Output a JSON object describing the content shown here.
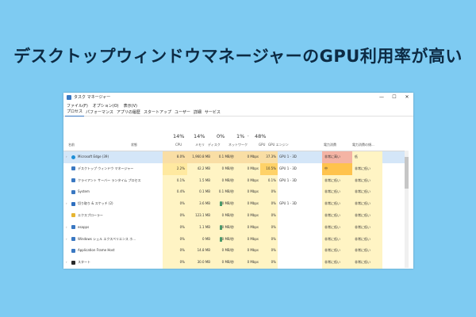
{
  "headline": "デスクトップウィンドウマネージャーのGPU利用率が高い",
  "window": {
    "title": "タスク マネージャー",
    "controls": [
      "—",
      "☐",
      "✕"
    ],
    "menu": [
      "ファイル(F)",
      "オプション(O)",
      "表示(V)"
    ],
    "tabs": [
      "プロセス",
      "パフォーマンス",
      "アプリの履歴",
      "スタートアップ",
      "ユーザー",
      "詳細",
      "サービス"
    ],
    "columns": {
      "name": "名前",
      "status": "状態",
      "cpu": {
        "pct": "14%",
        "label": "CPU"
      },
      "memory": {
        "pct": "14%",
        "label": "メモリ"
      },
      "disk": {
        "pct": "0%",
        "label": "ディスク"
      },
      "network": {
        "pct": "1%",
        "label": "ネットワーク"
      },
      "gpu": {
        "pct": "48%",
        "label": "GPU"
      },
      "gpu_engine": {
        "label": "GPU エンジン"
      },
      "power": {
        "label": "電力消費"
      },
      "power_trend": {
        "label": "電力消費の傾..."
      }
    },
    "rows": [
      {
        "name": "Microsoft Edge (39)",
        "cpu": "8.0%",
        "memory": "1,960.8 MB",
        "disk": "0.1 MB/秒",
        "network": "0 Mbps",
        "gpu": "37.3%",
        "gpu_engine": "GPU 1 - 3D",
        "power": "非常に高い",
        "power_trend": "低",
        "expand": "›",
        "icon_color": "#1f8fd6",
        "selected": true
      },
      {
        "name": "デスクトップ ウィンドウ マネージャー",
        "cpu": "2.2%",
        "memory": "42.2 MB",
        "disk": "0 MB/秒",
        "network": "0 Mbps",
        "gpu": "10.5%",
        "gpu_engine": "GPU 1 - 3D",
        "power": "中",
        "power_trend": "非常に低い",
        "expand": "",
        "icon_color": "#3a78c2"
      },
      {
        "name": "クライアント サーバー ランタイム プロセス",
        "cpu": "0.1%",
        "memory": "1.5 MB",
        "disk": "0 MB/秒",
        "network": "0 Mbps",
        "gpu": "0.1%",
        "gpu_engine": "GPU 1 - 3D",
        "power": "非常に低い",
        "power_trend": "非常に低い",
        "expand": "",
        "icon_color": "#3a78c2"
      },
      {
        "name": "System",
        "cpu": "0.4%",
        "memory": "0.1 MB",
        "disk": "0.1 MB/秒",
        "network": "0 Mbps",
        "gpu": "0%",
        "gpu_engine": "",
        "power": "非常に低い",
        "power_trend": "非常に低い",
        "expand": "",
        "icon_color": "#3a78c2"
      },
      {
        "name": "切り取り & スケッチ (2)",
        "cpu": "0%",
        "memory": "3.6 MB",
        "disk": "0 MB/秒",
        "network": "0 Mbps",
        "gpu": "0%",
        "gpu_engine": "GPU 1 - 3D",
        "power": "非常に低い",
        "power_trend": "非常に低い",
        "expand": "›",
        "icon_color": "#2f6fbf",
        "leaf": true
      },
      {
        "name": "エクスプローラー",
        "cpu": "0%",
        "memory": "123.1 MB",
        "disk": "0 MB/秒",
        "network": "0 Mbps",
        "gpu": "0%",
        "gpu_engine": "",
        "power": "非常に低い",
        "power_trend": "非常に低い",
        "expand": "",
        "icon_color": "#e6b532"
      },
      {
        "name": "esapps",
        "cpu": "0%",
        "memory": "1.1 MB",
        "disk": "0 MB/秒",
        "network": "0 Mbps",
        "gpu": "0%",
        "gpu_engine": "",
        "power": "非常に低い",
        "power_trend": "非常に低い",
        "expand": "›",
        "icon_color": "#3a78c2",
        "leaf": true
      },
      {
        "name": "Windows シェル エクスペリエンス ホ...",
        "cpu": "0%",
        "memory": "0 MB",
        "disk": "0 MB/秒",
        "network": "0 Mbps",
        "gpu": "0%",
        "gpu_engine": "",
        "power": "非常に低い",
        "power_trend": "非常に低い",
        "expand": "›",
        "icon_color": "#3a78c2",
        "leaf": true
      },
      {
        "name": "Application Frame Host",
        "cpu": "0%",
        "memory": "14.8 MB",
        "disk": "0 MB/秒",
        "network": "0 Mbps",
        "gpu": "0%",
        "gpu_engine": "",
        "power": "非常に低い",
        "power_trend": "非常に低い",
        "expand": "",
        "icon_color": "#3a78c2"
      },
      {
        "name": "スタート",
        "cpu": "0%",
        "memory": "30.0 MB",
        "disk": "0 MB/秒",
        "network": "0 Mbps",
        "gpu": "0%",
        "gpu_engine": "",
        "power": "非常に低い",
        "power_trend": "非常に低い",
        "expand": "›",
        "icon_color": "#2a2a2a"
      }
    ],
    "colors": {
      "cell_light": "#fff4c4",
      "cell_mid": "#ffe9a0",
      "cell_hot": "#ffd268",
      "power_very_high": "#f4b4a4",
      "power_medium": "#ffc34d"
    }
  }
}
